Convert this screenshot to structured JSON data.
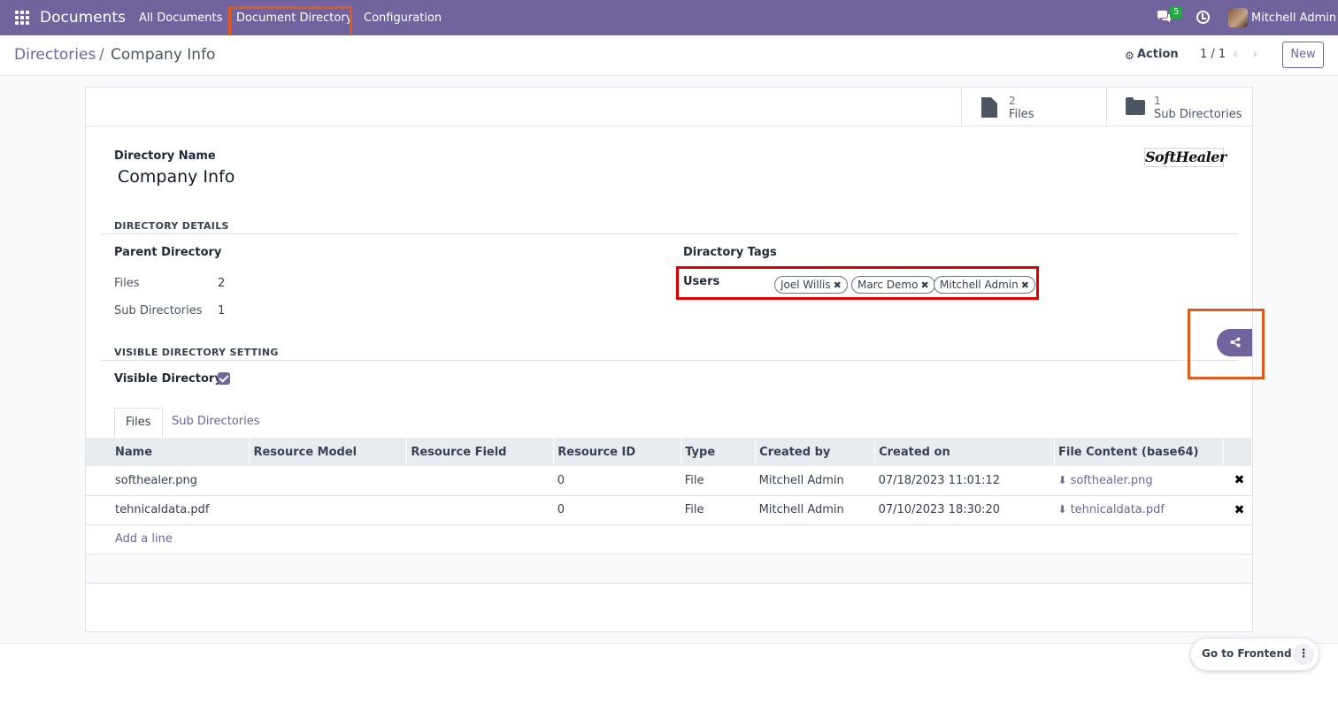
{
  "navbar": {
    "brand": "Documents",
    "menus": [
      "All Documents",
      "Document Directory",
      "Configuration"
    ],
    "chat_count": "5",
    "user": "Mitchell Admin"
  },
  "control_panel": {
    "breadcrumb_parent": "Directories",
    "breadcrumb_current": "Company Info",
    "action_label": "Action",
    "pager": "1 / 1",
    "new_label": "New"
  },
  "smart_buttons": [
    {
      "value": "2",
      "label": "Files"
    },
    {
      "value": "1",
      "label": "Sub Directories"
    }
  ],
  "form": {
    "name_label": "Directory Name",
    "name_value": "Company Info",
    "logo_text": "SoftHealer",
    "details_title": "DIRECTORY DETAILS",
    "parent_label": "Parent Directory",
    "files_label": "Files",
    "files_value": "2",
    "subdirs_label": "Sub Directories",
    "subdirs_value": "1",
    "tags_label": "Diractory Tags",
    "users_label": "Users",
    "users": [
      "Joel Willis",
      "Marc Demo",
      "Mitchell Admin"
    ],
    "visible_title": "VISIBLE DIRECTORY SETTING",
    "visible_label": "Visible Directory"
  },
  "tabs": [
    "Files",
    "Sub Directories"
  ],
  "table": {
    "headers": [
      "Name",
      "Resource Model",
      "Resource Field",
      "Resource ID",
      "Type",
      "Created by",
      "Created on",
      "File Content (base64)"
    ],
    "rows": [
      {
        "name": "softhealer.png",
        "model": "",
        "field": "",
        "res_id": "0",
        "type": "File",
        "created_by": "Mitchell Admin",
        "created_on": "07/18/2023 11:01:12",
        "content": "softhealer.png"
      },
      {
        "name": "tehnicaldata.pdf",
        "model": "",
        "field": "",
        "res_id": "0",
        "type": "File",
        "created_by": "Mitchell Admin",
        "created_on": "07/10/2023 18:30:20",
        "content": "tehnicaldata.pdf"
      }
    ],
    "add_line": "Add a line"
  },
  "frontend_label": "Go to Frontend",
  "colors": {
    "brand": "#71639e",
    "highlight_orange": "#e05a20",
    "highlight_red": "#e00000"
  }
}
